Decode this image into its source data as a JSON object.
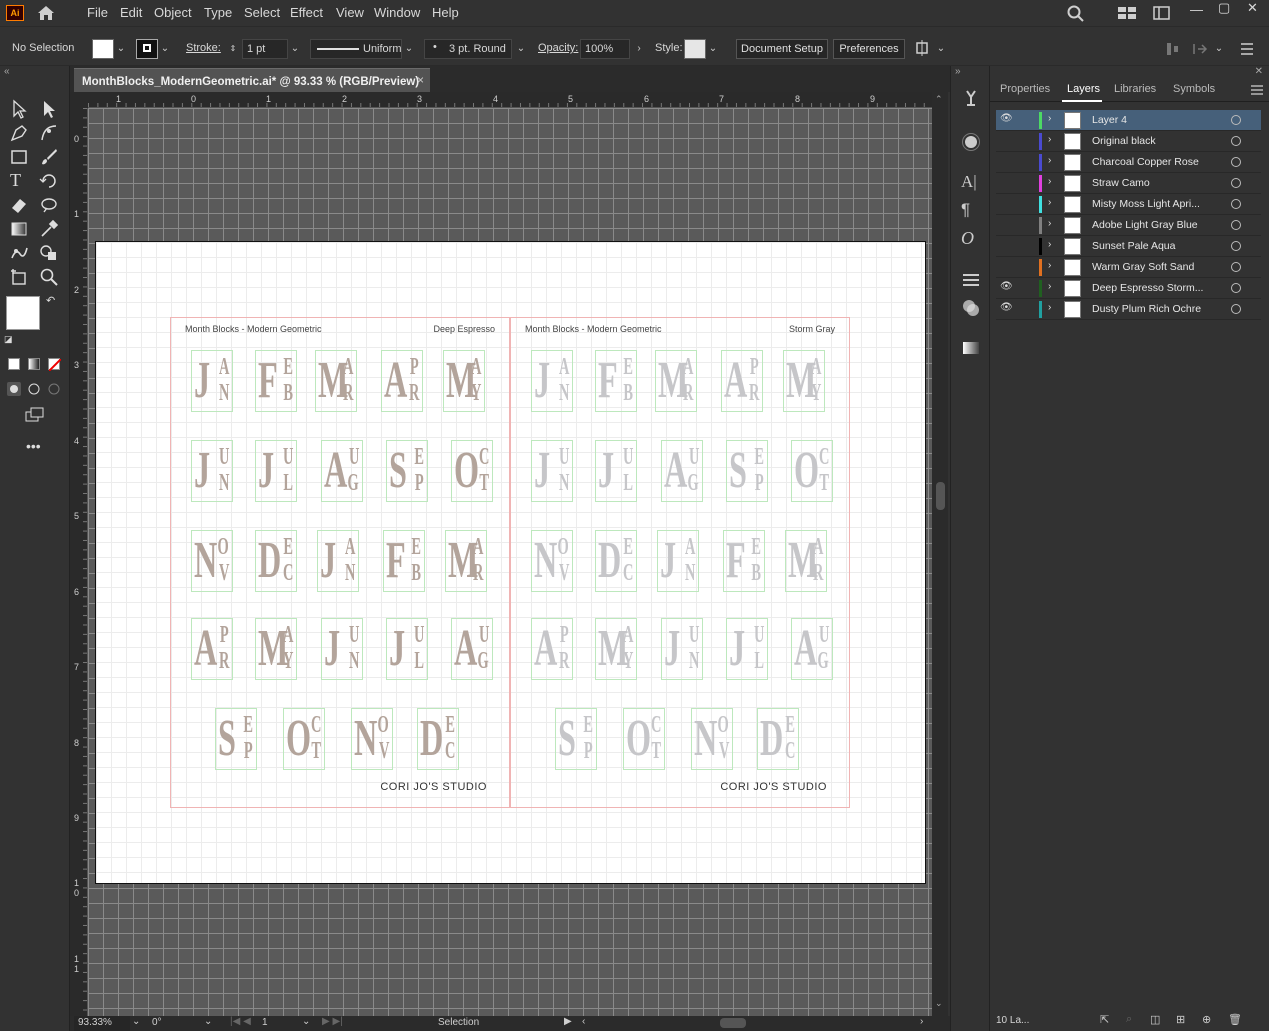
{
  "app": {
    "logo": "Ai"
  },
  "menu": [
    "File",
    "Edit",
    "Object",
    "Type",
    "Select",
    "Effect",
    "View",
    "Window",
    "Help"
  ],
  "control": {
    "selection": "No Selection",
    "stroke_label": "Stroke:",
    "stroke_weight": "1 pt",
    "stroke_profile": "Uniform",
    "brush": "3 pt. Round",
    "opacity_label": "Opacity:",
    "opacity": "100%",
    "style_label": "Style:",
    "document_setup": "Document Setup",
    "preferences": "Preferences"
  },
  "document": {
    "tab_title": "MonthBlocks_ModernGeometric.ai* @ 93.33 % (RGB/Preview)",
    "close": "×"
  },
  "rulers": {
    "h": [
      "1",
      "0",
      "1",
      "2",
      "3",
      "4",
      "5",
      "6",
      "7",
      "8",
      "9"
    ],
    "v": [
      "0",
      "1",
      "2",
      "3",
      "4",
      "5",
      "6",
      "7",
      "8",
      "9",
      "1\n0",
      "1\n1"
    ]
  },
  "sheets": [
    {
      "title": "Month Blocks - Modern Geometric",
      "color_name": "Deep Espresso",
      "footer": "CORI JO'S STUDIO",
      "ink": "#b3a49b"
    },
    {
      "title": "Month Blocks - Modern Geometric",
      "color_name": "Storm Gray",
      "footer": "CORI JO'S STUDIO",
      "ink": "#c6c6c9"
    }
  ],
  "months": [
    [
      "J",
      "A",
      "N"
    ],
    [
      "F",
      "E",
      "B"
    ],
    [
      "M",
      "A",
      "R"
    ],
    [
      "A",
      "P",
      "R"
    ],
    [
      "M",
      "A",
      "Y"
    ],
    [
      "J",
      "U",
      "N"
    ],
    [
      "J",
      "U",
      "L"
    ],
    [
      "A",
      "U",
      "G"
    ],
    [
      "S",
      "E",
      "P"
    ],
    [
      "O",
      "C",
      "T"
    ],
    [
      "N",
      "O",
      "V"
    ],
    [
      "D",
      "E",
      "C"
    ],
    [
      "J",
      "A",
      "N"
    ],
    [
      "F",
      "E",
      "B"
    ],
    [
      "M",
      "A",
      "R"
    ],
    [
      "A",
      "P",
      "R"
    ],
    [
      "M",
      "A",
      "Y"
    ],
    [
      "J",
      "U",
      "N"
    ],
    [
      "J",
      "U",
      "L"
    ],
    [
      "A",
      "U",
      "G"
    ],
    [
      "S",
      "E",
      "P"
    ],
    [
      "O",
      "C",
      "T"
    ],
    [
      "N",
      "O",
      "V"
    ],
    [
      "D",
      "E",
      "C"
    ]
  ],
  "status": {
    "zoom": "93.33%",
    "rotation": "0°",
    "artboard": "1",
    "mode": "Selection"
  },
  "panel": {
    "tabs": [
      "Properties",
      "Layers",
      "Libraries",
      "Symbols"
    ],
    "active_tab": "Layers",
    "layer_count": "10 La...",
    "layers": [
      {
        "name": "Layer 4",
        "color": "#4cd964",
        "visible": true,
        "selected": true
      },
      {
        "name": "Original black",
        "color": "#4a4ad0",
        "visible": false,
        "selected": false
      },
      {
        "name": "Charcoal Copper Rose",
        "color": "#4a4ad0",
        "visible": false,
        "selected": false
      },
      {
        "name": "Straw Camo",
        "color": "#e040e0",
        "visible": false,
        "selected": false
      },
      {
        "name": "Misty Moss Light Apri...",
        "color": "#40e0e0",
        "visible": false,
        "selected": false
      },
      {
        "name": "Adobe Light Gray Blue",
        "color": "#808080",
        "visible": false,
        "selected": false
      },
      {
        "name": "Sunset Pale Aqua",
        "color": "#000000",
        "visible": false,
        "selected": false
      },
      {
        "name": "Warm Gray Soft Sand",
        "color": "#e07020",
        "visible": false,
        "selected": false
      },
      {
        "name": "Deep Espresso Storm...",
        "color": "#206020",
        "visible": true,
        "selected": false
      },
      {
        "name": "Dusty Plum Rich Ochre",
        "color": "#20a0a0",
        "visible": true,
        "selected": false
      }
    ]
  }
}
